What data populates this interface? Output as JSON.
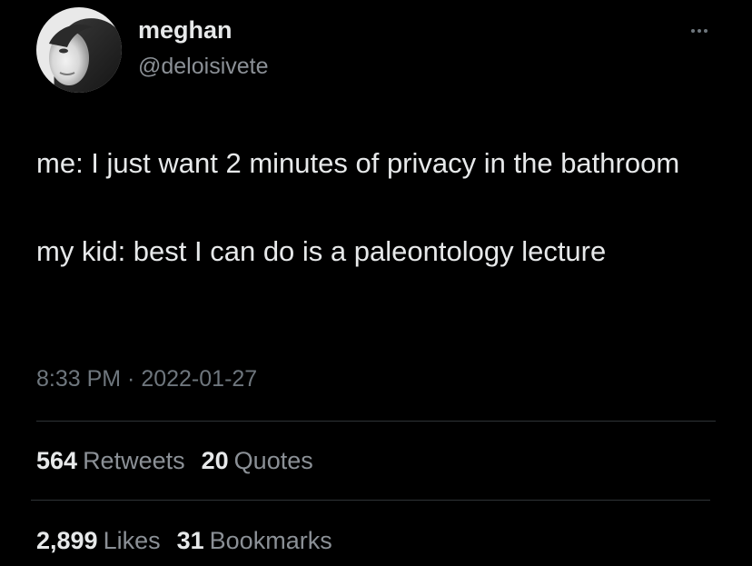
{
  "author": {
    "display_name": "meghan",
    "handle": "@deloisivete"
  },
  "tweet": {
    "paragraphs": [
      "me: I just want 2 minutes of privacy in the bathroom",
      "my kid: best I can do is a paleontology lecture"
    ],
    "timestamp": "8:33 PM · 2022-01-27"
  },
  "stats": {
    "retweets_count": "564",
    "retweets_label": "Retweets",
    "quotes_count": "20",
    "quotes_label": "Quotes",
    "likes_count": "2,899",
    "likes_label": "Likes",
    "bookmarks_count": "31",
    "bookmarks_label": "Bookmarks"
  },
  "colors": {
    "background": "#000000",
    "primary_text": "#e7e9ea",
    "secondary_text": "#8b9096",
    "divider": "#2f3336"
  }
}
